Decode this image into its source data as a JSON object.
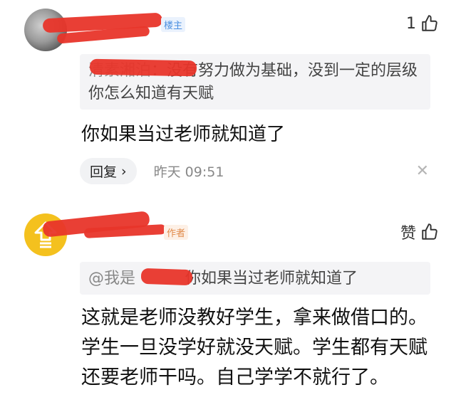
{
  "comments": [
    {
      "badge": "楼主",
      "likes": "1",
      "quote": {
        "name": "清素湘泊",
        "text": "：没有努力做为基础，没到一定的层级你怎么知道有天赋"
      },
      "text": "你如果当过老师就知道了",
      "reply_label": "回复",
      "reply_arrow": "›",
      "time": "昨天  09:51",
      "close": "✕"
    },
    {
      "badge": "作者",
      "likes": "赞",
      "quote": {
        "name": "@我是",
        "text": "你如果当过老师就知道了"
      },
      "text": "这就是老师没教好学生，拿来做借口的。学生一旦没学好就没天赋。学生都有天赋还要老师干吗。自己学学不就行了。"
    }
  ],
  "colors": {
    "redaction": "#e8352a",
    "badge_blue": "#4a8fe0",
    "avatar_yellow": "#f4c11e"
  }
}
